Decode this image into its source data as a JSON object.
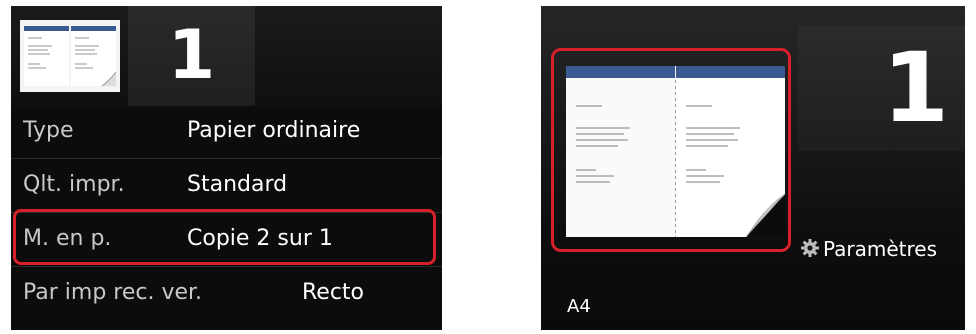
{
  "left_screen": {
    "copies": "1",
    "settings": [
      {
        "label": "Type",
        "value": "Papier ordinaire"
      },
      {
        "label": "Qlt. impr.",
        "value": "Standard"
      },
      {
        "label": "M. en p.",
        "value": "Copie 2 sur 1"
      },
      {
        "label": "Par imp rec. ver.",
        "value": "Recto"
      }
    ],
    "selected_setting": "M. en p."
  },
  "right_screen": {
    "copies": "1",
    "settings_button": "Paramètres",
    "paper_size": "A4"
  },
  "colors": {
    "highlight": "#d8202a",
    "page_header": "#3a5a94",
    "screen_bg": "#0c0c0c"
  },
  "icons": [
    "two-page-thumbnail-icon",
    "gear-icon",
    "two-page-preview-icon"
  ]
}
